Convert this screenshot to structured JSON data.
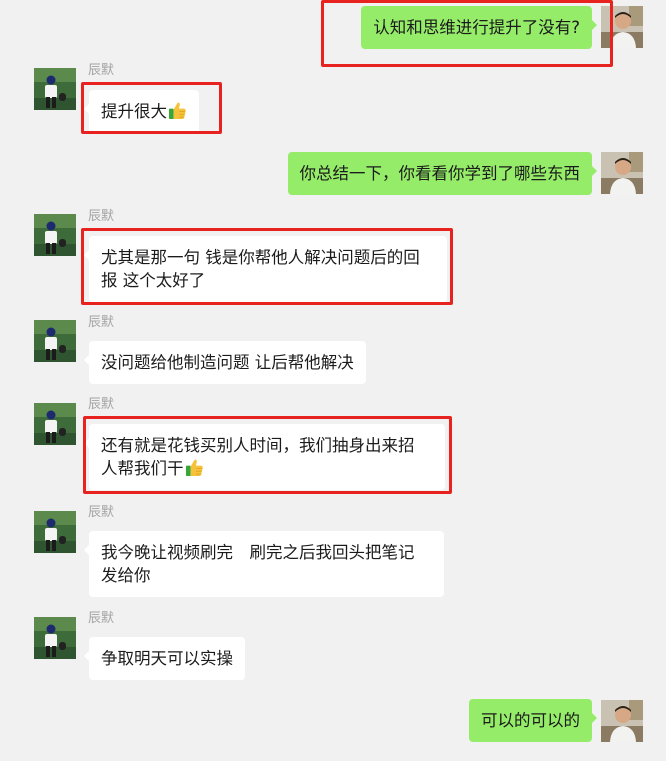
{
  "contacts": {
    "other_name": "辰默"
  },
  "icons": {
    "thumbs_up": "thumbs-up-emoji-icon"
  },
  "colors": {
    "background": "#f1f1f1",
    "self_bubble": "#95ec69",
    "other_bubble": "#ffffff",
    "highlight": "#e8231f",
    "name_text": "#a3a3a3"
  },
  "messages": [
    {
      "sender": "self",
      "text": "认知和思维进行提升了没有?"
    },
    {
      "sender": "other",
      "text": "提升很大",
      "emoji": "thumbs-up"
    },
    {
      "sender": "self",
      "text": "你总结一下，你看看你学到了哪些东西"
    },
    {
      "sender": "other",
      "text_line1": "尤其是那一句 钱是你帮他人解决问题后的回",
      "text_line2": "报 这个太好了"
    },
    {
      "sender": "other",
      "text": "没问题给他制造问题 让后帮他解决"
    },
    {
      "sender": "other",
      "text_line1": "还有就是花钱买别人时间，我们抽身出来招",
      "text_line2": "人帮我们干",
      "emoji": "thumbs-up"
    },
    {
      "sender": "other",
      "text_line1": "我今晚让视频刷完　刷完之后我回头把笔记",
      "text_line2": "发给你"
    },
    {
      "sender": "other",
      "text": "争取明天可以实操"
    },
    {
      "sender": "self",
      "text": "可以的可以的"
    }
  ]
}
